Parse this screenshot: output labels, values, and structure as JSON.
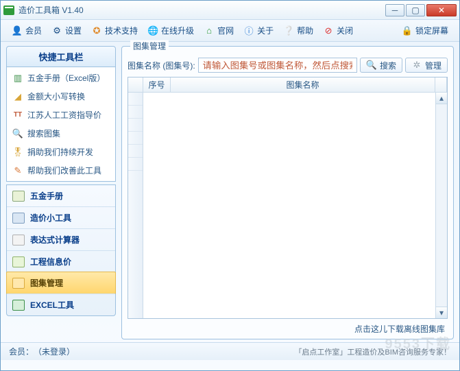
{
  "window": {
    "title": "造价工具箱 V1.40"
  },
  "toolbar": {
    "member": "会员",
    "settings": "设置",
    "support": "技术支持",
    "update": "在线升级",
    "website": "官网",
    "about": "关于",
    "help": "帮助",
    "close": "关闭",
    "lock": "锁定屏幕"
  },
  "sidebar": {
    "quick_title": "快捷工具栏",
    "quick_items": [
      "五金手册（Excel版）",
      "金额大小写转换",
      "江苏人工工资指导价",
      "搜索图集",
      "捐助我们持续开发",
      "帮助我们改善此工具"
    ],
    "nav_items": [
      "五金手册",
      "造价小工具",
      "表达式计算器",
      "工程信息价",
      "图集管理",
      "EXCEL工具"
    ],
    "nav_active_index": 4
  },
  "main": {
    "group_title": "图集管理",
    "search_label": "图集名称 (图集号):",
    "search_placeholder": "请输入图集号或图集名称，然后点搜索按钮！",
    "search_btn": "搜索",
    "manage_btn": "管理",
    "columns": {
      "seq": "序号",
      "name": "图集名称"
    },
    "download_link": "点击这儿下载离线图集库"
  },
  "status": {
    "left_label": "会员：",
    "left_value": "（未登录）",
    "right": "「启点工作室」工程造价及BIM咨询服务专家！"
  },
  "watermark": "9553下载"
}
